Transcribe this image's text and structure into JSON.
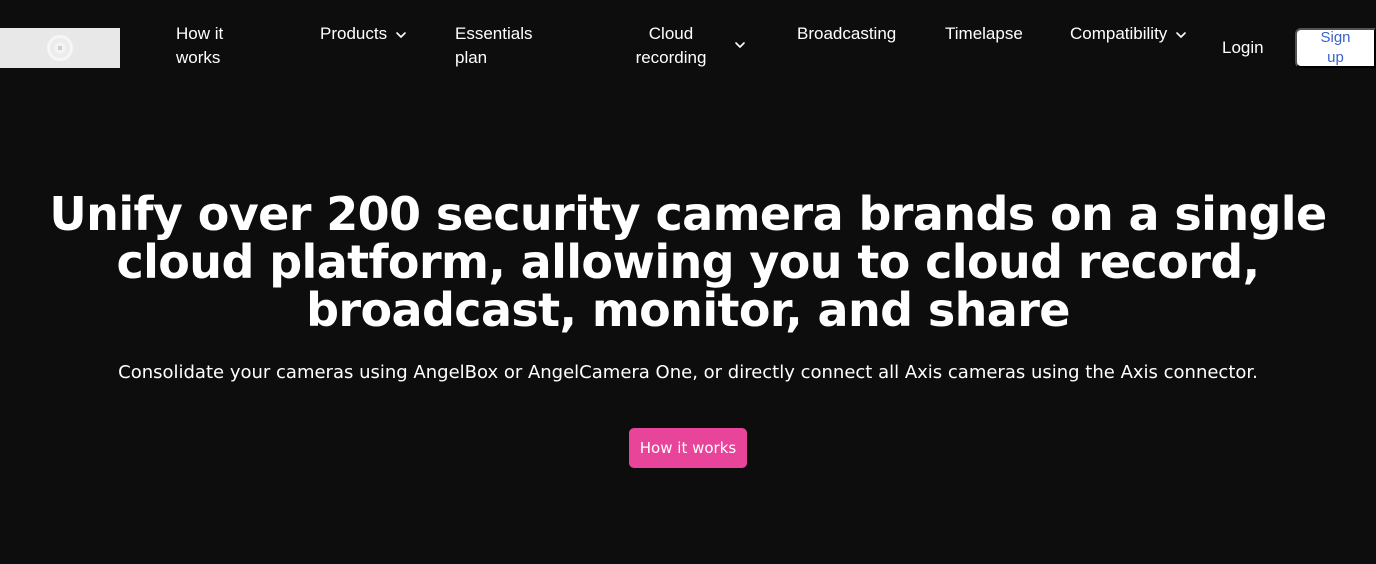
{
  "nav": {
    "how_it_works": "How it works",
    "products": "Products",
    "essentials_plan": "Essentials plan",
    "cloud_recording": "Cloud recording",
    "broadcasting": "Broadcasting",
    "timelapse": "Timelapse",
    "compatibility": "Compatibility",
    "login": "Login",
    "signup": "Sign up"
  },
  "hero": {
    "title": "Unify over 200 security camera brands on a single cloud platform, allowing you to cloud record, broadcast, monitor, and share",
    "subtitle": "Consolidate your cameras using AngelBox or AngelCamera One, or directly connect all Axis cameras using the Axis connector.",
    "cta_label": "How it works"
  },
  "colors": {
    "background": "#0d0d0d",
    "cta": "#e8449a",
    "signup_text": "#3a63c8",
    "text": "#ffffff"
  },
  "icons": {
    "dropdown": "chevron-down-icon",
    "logo": "logo-icon"
  }
}
